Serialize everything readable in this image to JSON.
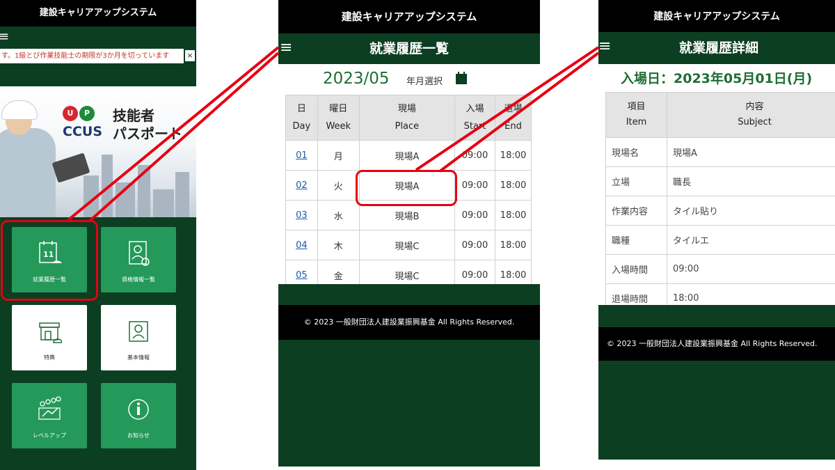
{
  "screen1": {
    "title": "建設キャリアアップシステム",
    "menu_icon": "≡",
    "notice": "す。1級とび作業技能士の期限が3か月を切っています",
    "notice_close": "×",
    "banner": {
      "logo_u": "U",
      "logo_p": "P",
      "logo_text": "CCUS",
      "passport_line1": "技能者",
      "passport_line2": "パスポート"
    },
    "tiles": [
      {
        "label": "就業履歴一覧",
        "icon": "calendar-helmet-icon",
        "style": "green"
      },
      {
        "label": "資格情報一覧",
        "icon": "certificate-icon",
        "style": "green"
      },
      {
        "label": "特典",
        "icon": "shop-icon",
        "style": "white"
      },
      {
        "label": "基本情報",
        "icon": "id-card-icon",
        "style": "white"
      },
      {
        "label": "レベルアップ",
        "icon": "people-level-icon",
        "style": "green"
      },
      {
        "label": "お知らせ",
        "icon": "info-icon",
        "style": "green"
      }
    ],
    "calendar_icon_text": "11"
  },
  "screen2": {
    "title": "建設キャリアアップシステム",
    "menu_icon": "≡",
    "screen_title": "就業履歴一覧",
    "month": "2023/05",
    "month_select_label": "年月選択",
    "headers": [
      {
        "jp": "日",
        "en": "Day"
      },
      {
        "jp": "曜日",
        "en": "Week"
      },
      {
        "jp": "現場",
        "en": "Place"
      },
      {
        "jp": "入場",
        "en": "Start"
      },
      {
        "jp": "退場",
        "en": "End"
      }
    ],
    "rows": [
      {
        "day": "01",
        "week": "月",
        "place": "現場A",
        "start": "09:00",
        "end": "18:00"
      },
      {
        "day": "02",
        "week": "火",
        "place": "現場A",
        "start": "09:00",
        "end": "18:00"
      },
      {
        "day": "03",
        "week": "水",
        "place": "現場B",
        "start": "09:00",
        "end": "18:00"
      },
      {
        "day": "04",
        "week": "木",
        "place": "現場C",
        "start": "09:00",
        "end": "18:00"
      },
      {
        "day": "05",
        "week": "金",
        "place": "現場C",
        "start": "09:00",
        "end": "18:00"
      }
    ],
    "footer": "© 2023 一般財団法人建設業振興基金 All Rights Reserved."
  },
  "screen3": {
    "title": "建設キャリアアップシステム",
    "menu_icon": "≡",
    "screen_title": "就業履歴詳細",
    "entry_date": "入場日：2023年05月01日(月)",
    "headers": [
      {
        "jp": "項目",
        "en": "Item"
      },
      {
        "jp": "内容",
        "en": "Subject"
      }
    ],
    "rows": [
      {
        "item": "現場名",
        "value": "現場A"
      },
      {
        "item": "立場",
        "value": "職長"
      },
      {
        "item": "作業内容",
        "value": "タイル貼り"
      },
      {
        "item": "職種",
        "value": "タイルエ"
      },
      {
        "item": "入場時間",
        "value": "09:00"
      },
      {
        "item": "退場時間",
        "value": "18:00"
      }
    ],
    "footer": "© 2023 一般財団法人建設業振興基金 All Rights Reserved."
  },
  "colors": {
    "dark_green": "#0c3e22",
    "tile_green": "#24995a",
    "accent_green": "#1f6e34",
    "highlight_red": "#e60012"
  }
}
